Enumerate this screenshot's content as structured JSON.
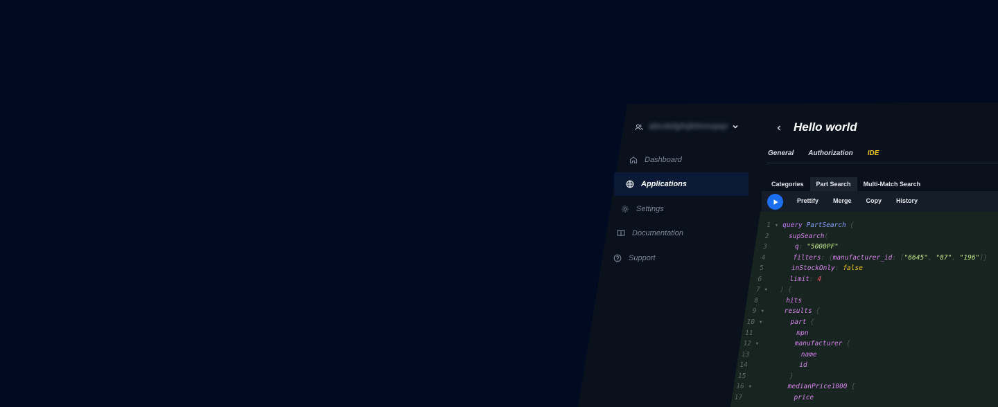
{
  "colors": {
    "background": "#000b22",
    "panel": "#0a111d",
    "active_nav": "#0a1a36",
    "accent_yellow": "#f0c419",
    "run_button": "#1c6ff0",
    "editor_bg": "#17241f"
  },
  "account": {
    "icon": "users-icon",
    "name": "abcdefghijklmnopqr",
    "chevron": "chevron-down-icon"
  },
  "sidebar": {
    "items": [
      {
        "label": "Dashboard",
        "icon": "home-icon",
        "active": false
      },
      {
        "label": "Applications",
        "icon": "globe-icon",
        "active": true
      },
      {
        "label": "Settings",
        "icon": "gear-icon",
        "active": false
      },
      {
        "label": "Documentation",
        "icon": "book-icon",
        "active": false
      },
      {
        "label": "Support",
        "icon": "help-circle-icon",
        "active": false
      }
    ]
  },
  "main": {
    "back_icon": "chevron-left-icon",
    "title": "Hello world",
    "tabs": [
      {
        "label": "General",
        "active": false
      },
      {
        "label": "Authorization",
        "active": false
      },
      {
        "label": "IDE",
        "active": true
      }
    ],
    "query_tabs": [
      {
        "label": "Categories",
        "active": false
      },
      {
        "label": "Part Search",
        "active": true
      },
      {
        "label": "Multi-Match Search",
        "active": false
      }
    ],
    "toolbar": {
      "run_icon": "play-icon",
      "actions": [
        "Prettify",
        "Merge",
        "Copy",
        "History"
      ]
    }
  },
  "editor": {
    "lines": [
      {
        "n": "1",
        "fold": true,
        "tokens": [
          [
            "kw",
            "query "
          ],
          [
            "ty",
            "PartSearch"
          ],
          [
            "punc",
            " {"
          ]
        ]
      },
      {
        "n": "2",
        "fold": false,
        "tokens": [
          [
            "fld",
            "  supSearch"
          ],
          [
            "punc",
            "("
          ]
        ]
      },
      {
        "n": "3",
        "fold": false,
        "tokens": [
          [
            "arg",
            "    q"
          ],
          [
            "punc",
            ": "
          ],
          [
            "str",
            "\"5000PF\""
          ]
        ]
      },
      {
        "n": "4",
        "fold": false,
        "tokens": [
          [
            "arg",
            "    filters"
          ],
          [
            "punc",
            ": {"
          ],
          [
            "arg",
            "manufacturer_id"
          ],
          [
            "punc",
            ": ["
          ],
          [
            "str",
            "\"6645\""
          ],
          [
            "punc",
            ", "
          ],
          [
            "str",
            "\"87\""
          ],
          [
            "punc",
            ", "
          ],
          [
            "str",
            "\"196\""
          ],
          [
            "punc",
            "]}"
          ]
        ]
      },
      {
        "n": "5",
        "fold": false,
        "tokens": [
          [
            "arg",
            "    inStockOnly"
          ],
          [
            "punc",
            ": "
          ],
          [
            "bool",
            "false"
          ]
        ]
      },
      {
        "n": "6",
        "fold": false,
        "tokens": [
          [
            "arg",
            "    limit"
          ],
          [
            "punc",
            ": "
          ],
          [
            "num",
            "4"
          ]
        ]
      },
      {
        "n": "7",
        "fold": true,
        "tokens": [
          [
            "punc",
            "  ) {"
          ]
        ]
      },
      {
        "n": "8",
        "fold": false,
        "tokens": [
          [
            "fld",
            "    hits"
          ]
        ]
      },
      {
        "n": "9",
        "fold": true,
        "tokens": [
          [
            "fld",
            "    results"
          ],
          [
            "punc",
            " {"
          ]
        ]
      },
      {
        "n": "10",
        "fold": true,
        "tokens": [
          [
            "fld",
            "      part"
          ],
          [
            "punc",
            " {"
          ]
        ]
      },
      {
        "n": "11",
        "fold": false,
        "tokens": [
          [
            "fld",
            "        mpn"
          ]
        ]
      },
      {
        "n": "12",
        "fold": true,
        "tokens": [
          [
            "fld",
            "        manufacturer"
          ],
          [
            "punc",
            " {"
          ]
        ]
      },
      {
        "n": "13",
        "fold": false,
        "tokens": [
          [
            "fld",
            "          name"
          ]
        ]
      },
      {
        "n": "14",
        "fold": false,
        "tokens": [
          [
            "fld",
            "          id"
          ]
        ]
      },
      {
        "n": "15",
        "fold": false,
        "tokens": [
          [
            "punc",
            "        }"
          ]
        ]
      },
      {
        "n": "16",
        "fold": true,
        "tokens": [
          [
            "fld",
            "        medianPrice1000"
          ],
          [
            "punc",
            " {"
          ]
        ]
      },
      {
        "n": "17",
        "fold": false,
        "tokens": [
          [
            "fld",
            "          price"
          ]
        ]
      }
    ]
  }
}
